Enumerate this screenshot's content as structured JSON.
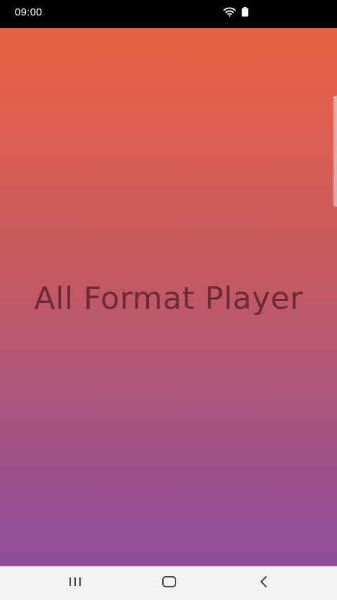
{
  "status_bar": {
    "time": "09:00",
    "icons": [
      "wifi-icon",
      "battery-icon"
    ]
  },
  "splash": {
    "title": "All Format Player",
    "gradient_top": "#e8613f",
    "gradient_bottom": "#8f4f9b",
    "title_color": "#6e2a35"
  },
  "nav_bar": {
    "buttons": [
      "recent-apps-icon",
      "home-icon",
      "back-icon"
    ]
  }
}
